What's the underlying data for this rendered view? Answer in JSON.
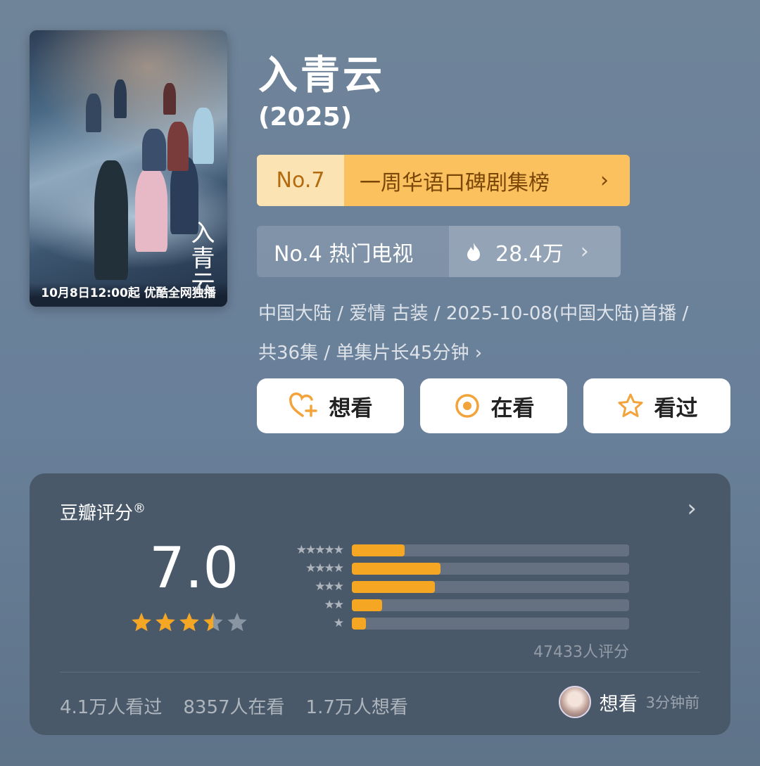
{
  "poster": {
    "calligraphy": "入青云",
    "caption": "10月8日12:00起 优酷全网独播"
  },
  "title": "入青云",
  "year": "(2025)",
  "rank_primary": {
    "rank": "No.7",
    "label": "一周华语口碑剧集榜",
    "chevron": "›"
  },
  "rank_secondary": {
    "label": "No.4 热门电视",
    "heat": "28.4万",
    "chevron": "›"
  },
  "meta": {
    "line1": "中国大陆 / 爱情 古装 / 2025-10-08(中国大陆)首播 /",
    "line2": "共36集 / 单集片长45分钟 ›"
  },
  "actions": [
    {
      "label": "想看",
      "icon": "heart-plus-icon"
    },
    {
      "label": "在看",
      "icon": "circle-dot-icon"
    },
    {
      "label": "看过",
      "icon": "star-outline-icon"
    }
  ],
  "rating": {
    "header": "豆瓣评分",
    "registered": "®",
    "score": "7.0",
    "stars_value": 3.5,
    "stars_max": 5,
    "distribution": [
      {
        "stars": 5,
        "fraction": 0.19
      },
      {
        "stars": 4,
        "fraction": 0.32
      },
      {
        "stars": 3,
        "fraction": 0.3
      },
      {
        "stars": 2,
        "fraction": 0.11
      },
      {
        "stars": 1,
        "fraction": 0.05
      }
    ],
    "count": "47433人评分",
    "footer": [
      "4.1万人看过",
      "8357人在看",
      "1.7万人想看"
    ],
    "user_status": "想看",
    "user_time": "3分钟前"
  },
  "colors": {
    "accent": "#f5a623",
    "rank_bg": "#fbc15e",
    "rank_text": "#7a4608"
  }
}
